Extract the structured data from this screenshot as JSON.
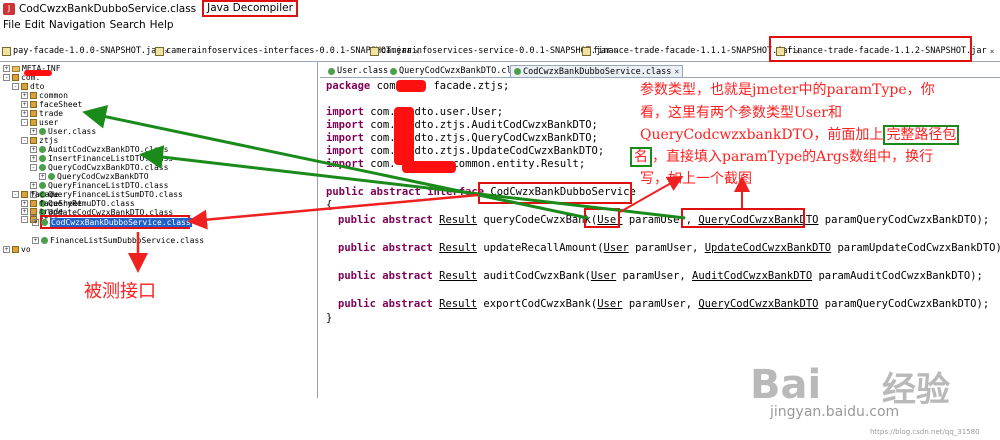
{
  "window": {
    "title": "CodCwzxBankDubboService.class",
    "app_name": "Java Decompiler"
  },
  "menu": [
    "File",
    "Edit",
    "Navigation",
    "Search",
    "Help"
  ],
  "jar_tabs": [
    "pay-facade-1.0.0-SNAPSHOT.jar",
    "camerainfoservices-interfaces-0.0.1-SNAPSHOT.jar",
    "camerainfoservices-service-0.0.1-SNAPSHOT.jar",
    "finance-trade-facade-1.1.1-SNAPSHOT.jar",
    "finance-trade-facade-1.1.2-SNAPSHOT.jar"
  ],
  "tree": {
    "meta_inf": "META-INF",
    "root": "com.",
    "dto": "dto",
    "common": "common",
    "faceSheet": "faceSheet",
    "trade": "trade",
    "user": "user",
    "user_class": "User.class",
    "ztjs": "ztjs",
    "ztjs_items": [
      "AuditCodCwzxBankDTO.class",
      "InsertFinanceListDTO.class",
      "QueryCodCwzxBankDTO.class",
      "QueryCodCwzxBankDTO",
      "QueryFinanceListDTO.class",
      "QueryFinanceListSumDTO.class",
      "QueryRemuDTO.class",
      "UpdateCodCwzxBankDTO.class"
    ],
    "facade": "facade",
    "facade_faceSheet": "faceSheet",
    "facade_trade": "trade",
    "ztjs2": "ztjs",
    "selected_class": "CodCwzxBankDubboService.class",
    "finance_sum": "FinanceListSumDubboService.class",
    "vo": "vo"
  },
  "editor_tabs": [
    "User.class",
    "QueryCodCwzxBankDTO.class",
    "CodCwzxBankDubboService.class"
  ],
  "code": {
    "package_line": [
      "package",
      " com.",
      "facade.ztjs;"
    ],
    "imports": [
      {
        "kw": "import",
        "a": " com.",
        "b": "dto.user.User;"
      },
      {
        "kw": "import",
        "a": " com.",
        "b": "dto.ztjs.AuditCodCwzxBankDTO;"
      },
      {
        "kw": "import",
        "a": " com.",
        "b": "dto.ztjs.QueryCodCwzxBankDTO;"
      },
      {
        "kw": "import",
        "a": " com.",
        "b": "dto.ztjs.UpdateCodCwzxBankDTO;"
      },
      {
        "kw": "import",
        "a": " com.",
        "b": "common.entity.Result;"
      }
    ],
    "iface_kw": "public abstract interface",
    "iface_name": "CodCwzxBankDubboService",
    "open_brace": "{",
    "close_brace": "}",
    "methods": [
      {
        "mod": "public abstract",
        "ret": "Result",
        "name": " queryCodeCwzxBank(",
        "p1t": "User",
        "p1n": " paramUser, ",
        "p2t": "QueryCodCwzxBankDTO",
        "p2n": " paramQueryCodCwzxBankDTO);"
      },
      {
        "mod": "public abstract",
        "ret": "Result",
        "name": " updateRecallAmount(",
        "p1t": "User",
        "p1n": " paramUser, ",
        "p2t": "UpdateCodCwzxBankDTO",
        "p2n": " paramUpdateCodCwzxBankDTO);"
      },
      {
        "mod": "public abstract",
        "ret": "Result",
        "name": " auditCodCwzxBank(",
        "p1t": "User",
        "p1n": " paramUser, ",
        "p2t": "AuditCodCwzxBankDTO",
        "p2n": " paramAuditCodCwzxBankDTO);"
      },
      {
        "mod": "public abstract",
        "ret": "Result",
        "name": " exportCodCwzxBank(",
        "p1t": "User",
        "p1n": " paramUser, ",
        "p2t": "QueryCodCwzxBankDTO",
        "p2n": " paramQueryCodCwzxBankDTO);"
      }
    ]
  },
  "annotations": {
    "note_lines": [
      "参数类型，也就是jmeter中的paramType，你",
      "看，这里有两个参数类型User和",
      "QueryCodcwzxbankDTO，前面加上",
      "完整路径包",
      "名",
      "，直接填入paramType的Args数组中，换行",
      "写，如上一个截图"
    ],
    "interface_label": "被测接口"
  },
  "watermark": {
    "brand": "Bai",
    "brand_cn": "经验",
    "url": "jingyan.baidu.com",
    "small": "https://blog.csdn.net/qq_31580"
  },
  "colors": {
    "annotation_red": "#e01010",
    "annotation_green": "#1a8a1a",
    "keyword": "#7f0055",
    "selection": "#2060c8"
  }
}
